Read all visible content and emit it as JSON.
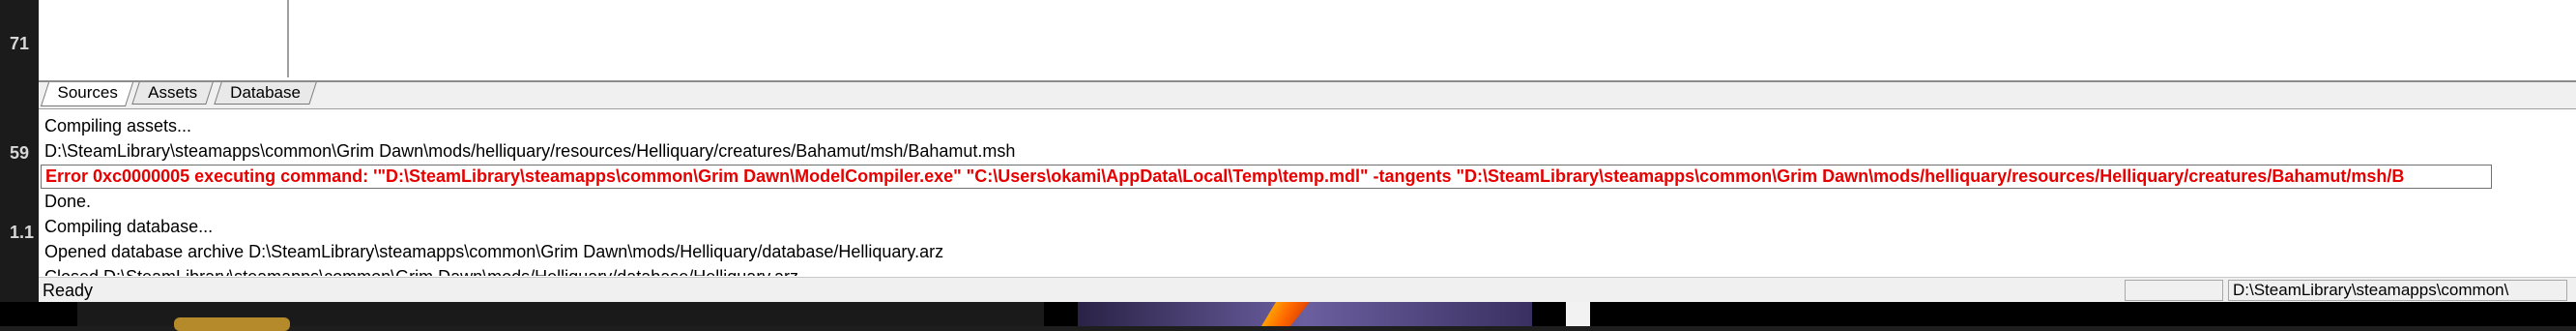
{
  "left_numbers": [
    "71",
    "59",
    "1.1"
  ],
  "tabs": [
    {
      "label": "Sources",
      "active": true
    },
    {
      "label": "Assets",
      "active": false
    },
    {
      "label": "Database",
      "active": false
    }
  ],
  "log": {
    "line1": "Compiling assets...",
    "line2": "D:\\SteamLibrary\\steamapps\\common\\Grim Dawn\\mods/helliquary/resources/Helliquary/creatures/Bahamut/msh/Bahamut.msh",
    "error": "Error 0xc0000005 executing command: '\"D:\\SteamLibrary\\steamapps\\common\\Grim Dawn\\ModelCompiler.exe\" \"C:\\Users\\okami\\AppData\\Local\\Temp\\temp.mdl\" -tangents \"D:\\SteamLibrary\\steamapps\\common\\Grim Dawn\\mods/helliquary/resources/Helliquary/creatures/Bahamut/msh/B",
    "line4": "Done.",
    "line5": "Compiling database...",
    "line6": "Opened database archive D:\\SteamLibrary\\steamapps\\common\\Grim Dawn\\mods/Helliquary/database/Helliquary.arz",
    "line7": "Closed D:\\SteamLibrary\\steamapps\\common\\Grim Dawn\\mods/Helliquary/database/Helliquary.arz"
  },
  "status": {
    "text": "Ready",
    "path": "D:\\SteamLibrary\\steamapps\\common\\"
  },
  "colors": {
    "error": "#e60000"
  }
}
